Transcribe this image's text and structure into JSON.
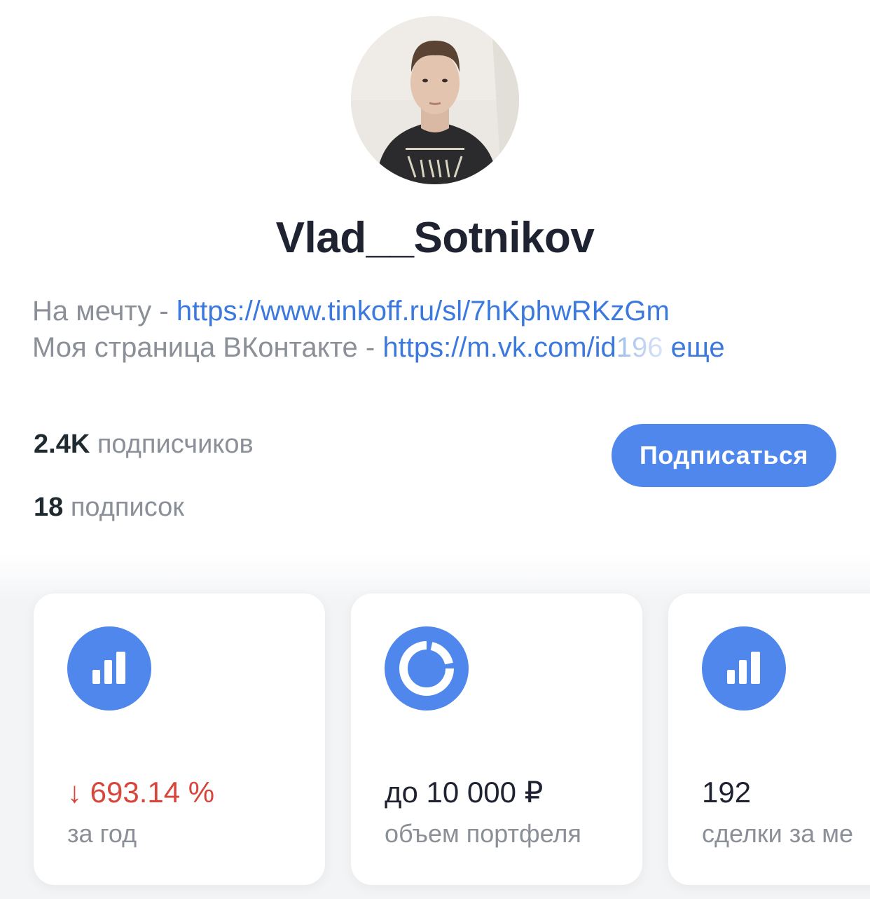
{
  "profile": {
    "username": "Vlad__Sotnikov",
    "bio": {
      "line1_prefix": "На мечту - ",
      "line1_link": "https://www.tinkoff.ru/sl/7hKphwRKzGm",
      "line2_prefix": "Моя страница ВКонтакте - ",
      "line2_link": "https://m.vk.com/id",
      "line2_link_faded": "196",
      "more": "еще"
    }
  },
  "stats": {
    "followers": {
      "value": "2.4K",
      "label": "подписчиков"
    },
    "following": {
      "value": "18",
      "label": "подписок"
    }
  },
  "actions": {
    "subscribe_label": "Подписаться"
  },
  "cards": [
    {
      "icon": "bar-chart-icon",
      "value": "↓ 693.14 %",
      "label": "за год"
    },
    {
      "icon": "donut-chart-icon",
      "value": "до 10 000 ₽",
      "label": "объем портфеля"
    },
    {
      "icon": "bar-chart-icon",
      "value": "192",
      "label": "сделки за ме"
    }
  ],
  "colors": {
    "accent": "#4f87ec",
    "link": "#3b79de",
    "negative": "#d8453a",
    "muted_text": "#8b8f97"
  }
}
